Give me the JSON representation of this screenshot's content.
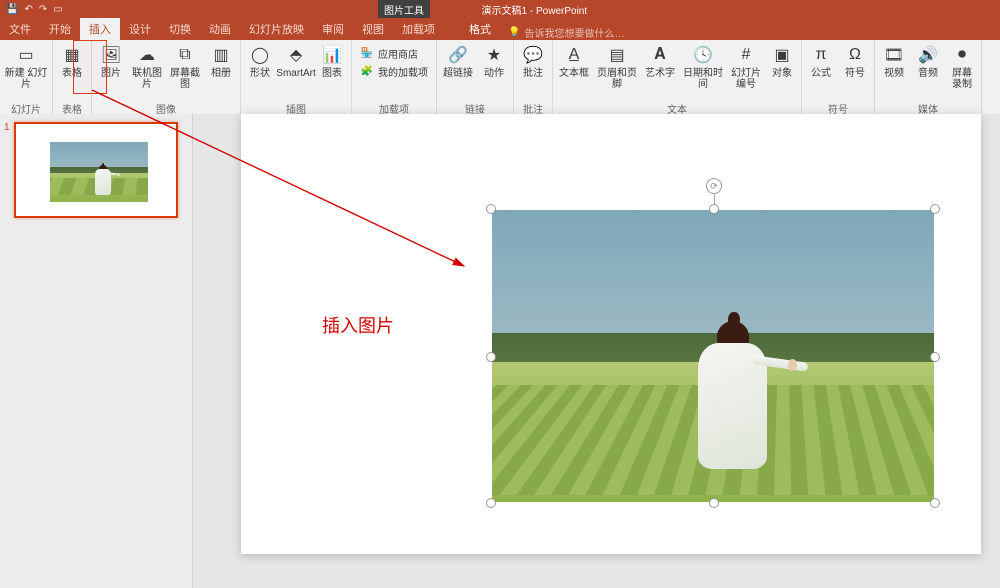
{
  "titlebar": {
    "title": "演示文稿1 - PowerPoint",
    "context_tool_title": "图片工具"
  },
  "tabs": {
    "file": "文件",
    "home": "开始",
    "insert": "插入",
    "design": "设计",
    "transitions": "切换",
    "animations": "动画",
    "slideshow": "幻灯片放映",
    "review": "审阅",
    "view": "视图",
    "addins": "加载项",
    "format": "格式",
    "tellme": "告诉我您想要做什么…"
  },
  "ribbon": {
    "groups": {
      "slides": "幻灯片",
      "tables": "表格",
      "images": "图像",
      "illustrations": "插图",
      "addins": "加载项",
      "links": "链接",
      "comments": "批注",
      "text": "文本",
      "symbols": "符号",
      "media": "媒体"
    },
    "buttons": {
      "new_slide": "新建\n幻灯片",
      "table": "表格",
      "pictures": "图片",
      "online_pictures": "联机图片",
      "screenshot": "屏幕截图",
      "photo_album": "相册",
      "shapes": "形状",
      "smartart": "SmartArt",
      "chart": "图表",
      "store": "应用商店",
      "my_addins": "我的加载项",
      "hyperlink": "超链接",
      "action": "动作",
      "comment": "批注",
      "text_box": "文本框",
      "header_footer": "页眉和页脚",
      "word_art": "艺术字",
      "date_time": "日期和时间",
      "slide_number": "幻灯片\n编号",
      "object": "对象",
      "equation": "公式",
      "symbol": "符号",
      "video": "视频",
      "audio": "音频",
      "screen_recording": "屏幕\n录制"
    }
  },
  "thumbs": {
    "slide1_num": "1"
  },
  "annotation": {
    "label": "插入图片"
  }
}
